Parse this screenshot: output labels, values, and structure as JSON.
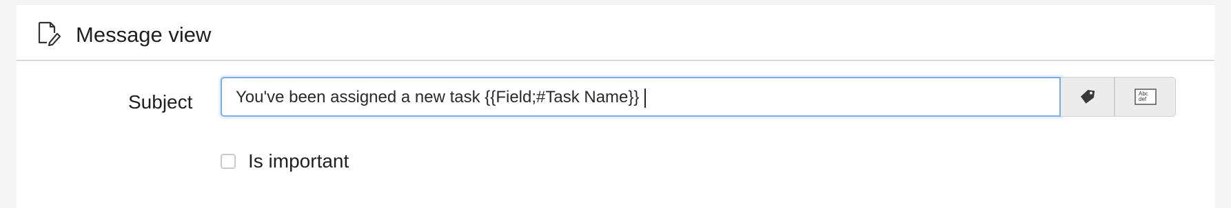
{
  "section": {
    "title": "Message view",
    "icon": "edit-document-icon"
  },
  "form": {
    "subject_label": "Subject",
    "subject_value": "You've been assigned a new task {{Field;#Task Name}}",
    "tag_button_icon": "tag-icon",
    "spellcheck_button_icon": "abc-def-icon",
    "abc_top": "Abc",
    "abc_bottom": "def",
    "important_label": "Is important",
    "important_checked": false
  },
  "colors": {
    "input_focus_border": "#79aee8",
    "addon_background": "#ececec",
    "divider": "#dcdcdc"
  }
}
